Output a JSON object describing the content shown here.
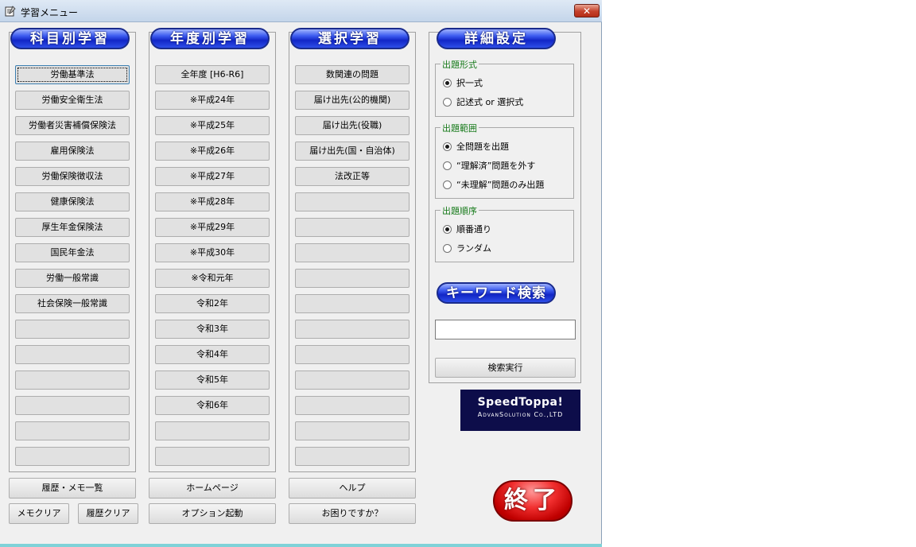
{
  "window": {
    "title": "学習メニュー",
    "close_label": "✕"
  },
  "headers": {
    "subject": "科目別学習",
    "year": "年度別学習",
    "select": "選択学習",
    "detail": "詳細設定",
    "keyword": "キーワード検索"
  },
  "subject_buttons": [
    "労働基準法",
    "労働安全衛生法",
    "労働者災害補償保険法",
    "雇用保険法",
    "労働保険徴収法",
    "健康保険法",
    "厚生年金保険法",
    "国民年金法",
    "労働一般常識",
    "社会保険一般常識",
    "",
    "",
    "",
    "",
    "",
    ""
  ],
  "year_buttons": [
    "全年度 [H6-R6]",
    "※平成24年",
    "※平成25年",
    "※平成26年",
    "※平成27年",
    "※平成28年",
    "※平成29年",
    "※平成30年",
    "※令和元年",
    "令和2年",
    "令和3年",
    "令和4年",
    "令和5年",
    "令和6年",
    "",
    ""
  ],
  "select_buttons": [
    "数関連の問題",
    "届け出先(公的機関)",
    "届け出先(役職)",
    "届け出先(国・自治体)",
    "法改正等",
    "",
    "",
    "",
    "",
    "",
    "",
    "",
    "",
    "",
    "",
    ""
  ],
  "bottom_buttons": {
    "history_memo": "履歴・メモ一覧",
    "memo_clear": "メモクリア",
    "history_clear": "履歴クリア",
    "homepage": "ホームページ",
    "option": "オプション起動",
    "help": "ヘルプ",
    "trouble": "お困りですか？"
  },
  "format_group": {
    "label": "出題形式",
    "options": [
      "択一式",
      "記述式 or 選択式"
    ],
    "selected": 0
  },
  "range_group": {
    "label": "出題範囲",
    "options": [
      "全問題を出題",
      "“理解済”問題を外す",
      "“未理解”問題のみ出題"
    ],
    "selected": 0
  },
  "order_group": {
    "label": "出題順序",
    "options": [
      "順番通り",
      "ランダム"
    ],
    "selected": 0
  },
  "search": {
    "value": "",
    "placeholder": "",
    "button_label": "検索実行"
  },
  "logo": {
    "line1": "SpeedToppa!",
    "line2": "AdvanSolution Co.,LTD"
  },
  "exit_label": "終了"
}
